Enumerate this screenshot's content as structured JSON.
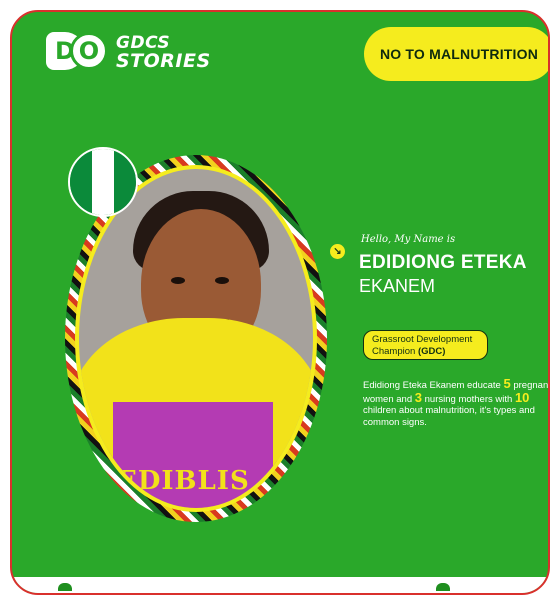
{
  "brand": {
    "mark_left": "D",
    "mark_right": "O",
    "line1": "GDCS",
    "line2": "STORIES"
  },
  "campaign_pill": "NO TO MALNUTRITION",
  "flag_name": "nigeria-flag",
  "intro": "Hello, My Name is",
  "person": {
    "name_line1": "EDIDIONG ETEKA",
    "name_line2": "EKANEM"
  },
  "role": {
    "text_plain": "Grassroot Development Champion",
    "text_bold": "(GDC)"
  },
  "shirt_text": "EDIBLIS",
  "description": {
    "part1": "Edidiong Eteka Ekanem educate",
    "num1": "5",
    "part2": "pregnant women and",
    "num2": "3",
    "part3": "nursing mothers with",
    "num3": "10",
    "part4": "children about malnutrition, it's types and common signs."
  },
  "colors": {
    "background": "#2aa82a",
    "accent": "#f5ec1e",
    "border": "#d9302c"
  }
}
